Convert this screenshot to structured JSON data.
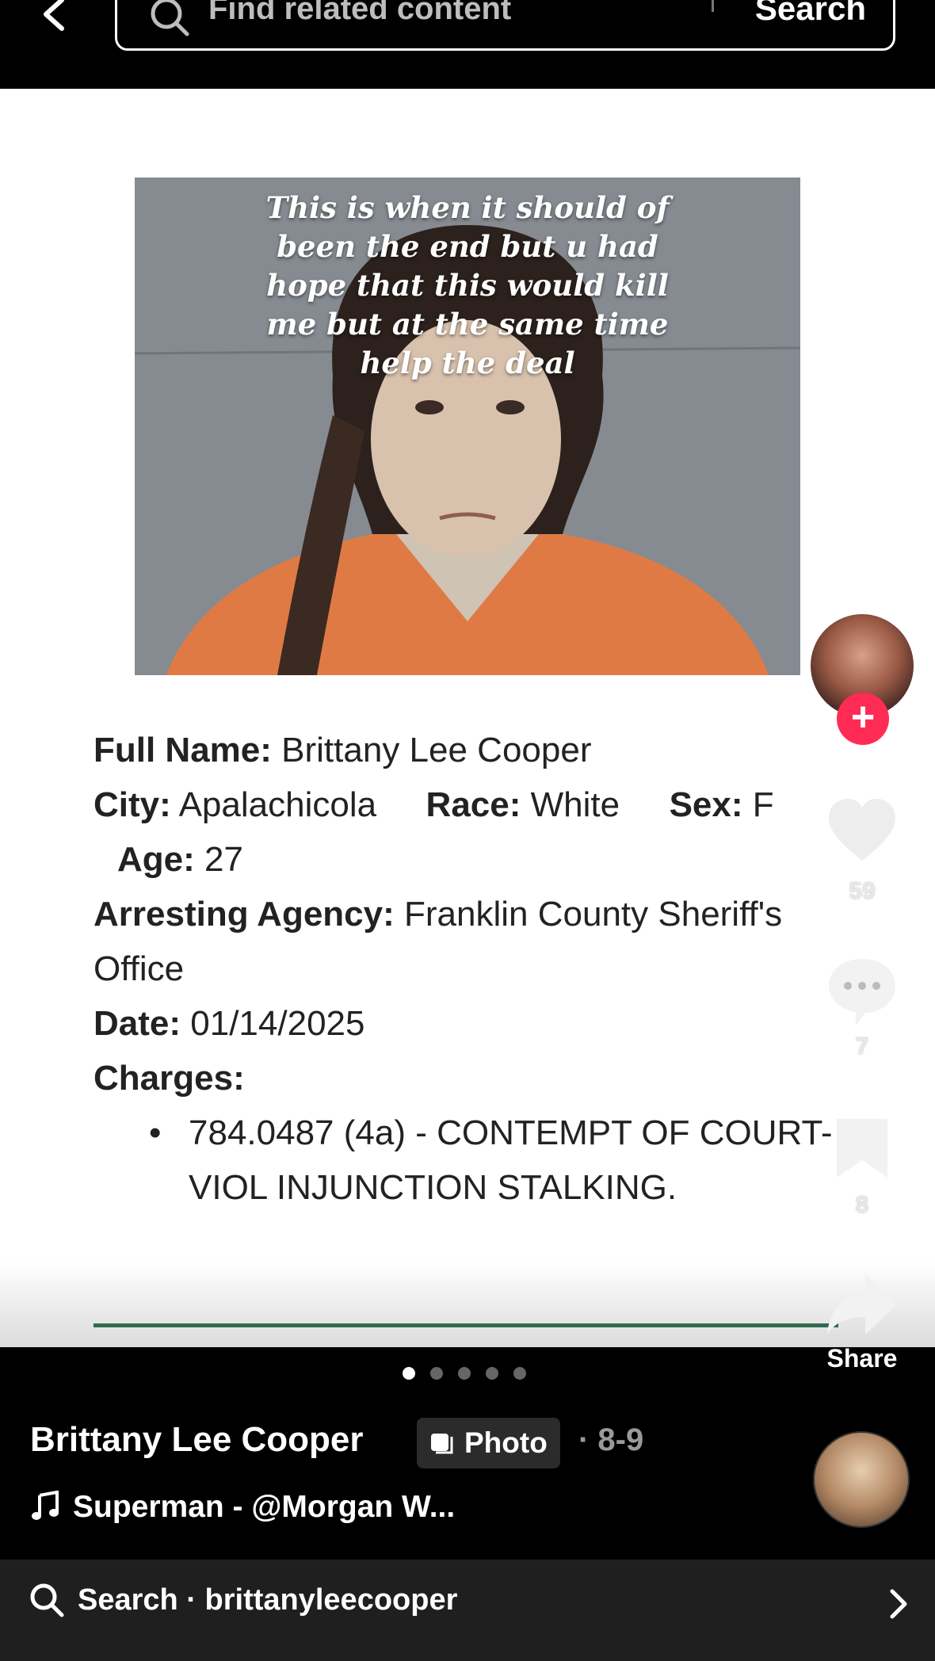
{
  "header": {
    "search_placeholder": "Find related content",
    "search_button": "Search"
  },
  "post": {
    "overlay_lines": [
      "This is when it should of",
      "been the end but u had",
      "hope that this would kill",
      "me but at the same time",
      "help the deal"
    ],
    "info": {
      "full_name_label": "Full Name:",
      "full_name": "Brittany Lee Cooper",
      "city_label": "City:",
      "city": "Apalachicola",
      "race_label": "Race:",
      "race": "White",
      "sex_label": "Sex:",
      "sex": "F",
      "age_label": "Age:",
      "age": "27",
      "agency_label": "Arresting Agency:",
      "agency": "Franklin County Sheriff's Office",
      "date_label": "Date:",
      "date": "01/14/2025",
      "charges_label": "Charges:",
      "charges": [
        "784.0487 (4a) - CONTEMPT OF COURT- VIOL INJUNCTION STALKING."
      ]
    }
  },
  "actions": {
    "likes": "59",
    "comments": "7",
    "saves": "8",
    "share_label": "Share"
  },
  "carousel": {
    "total": 5,
    "active_index": 0
  },
  "meta": {
    "author": "Brittany Lee Cooper",
    "badge": "Photo",
    "date": "· 8-9",
    "music": "Superman - @Morgan W..."
  },
  "bottom_search": {
    "text": "Search · brittanyleecooper"
  },
  "colors": {
    "follow": "#fe2c55",
    "progress": "#2e6b50",
    "background": "#000000"
  }
}
